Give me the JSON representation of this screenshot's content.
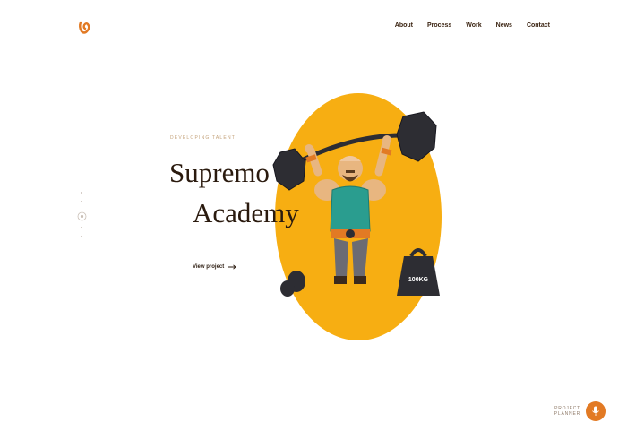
{
  "header": {
    "logo_icon": "logo-icon",
    "nav": [
      {
        "label": "About"
      },
      {
        "label": "Process"
      },
      {
        "label": "Work"
      },
      {
        "label": "News"
      },
      {
        "label": "Contact"
      }
    ]
  },
  "pager": {
    "count": 5,
    "active_index": 2
  },
  "hero": {
    "eyebrow": "DEVELOPING TALENT",
    "title_line1": "Supremo",
    "title_line2": "Academy",
    "cta_label": "View project",
    "cta_icon": "arrow-right-icon",
    "illustration": "strongman-lifting-barbell",
    "weight_label": "100KG"
  },
  "planner": {
    "line1": "PROJECT",
    "line2": "PLANNER",
    "icon": "microphone-icon"
  },
  "colors": {
    "accent_orange": "#F7AE12",
    "badge_orange": "#E27A24",
    "text_dark": "#2A1A0E",
    "eyebrow": "#C4A27A"
  }
}
